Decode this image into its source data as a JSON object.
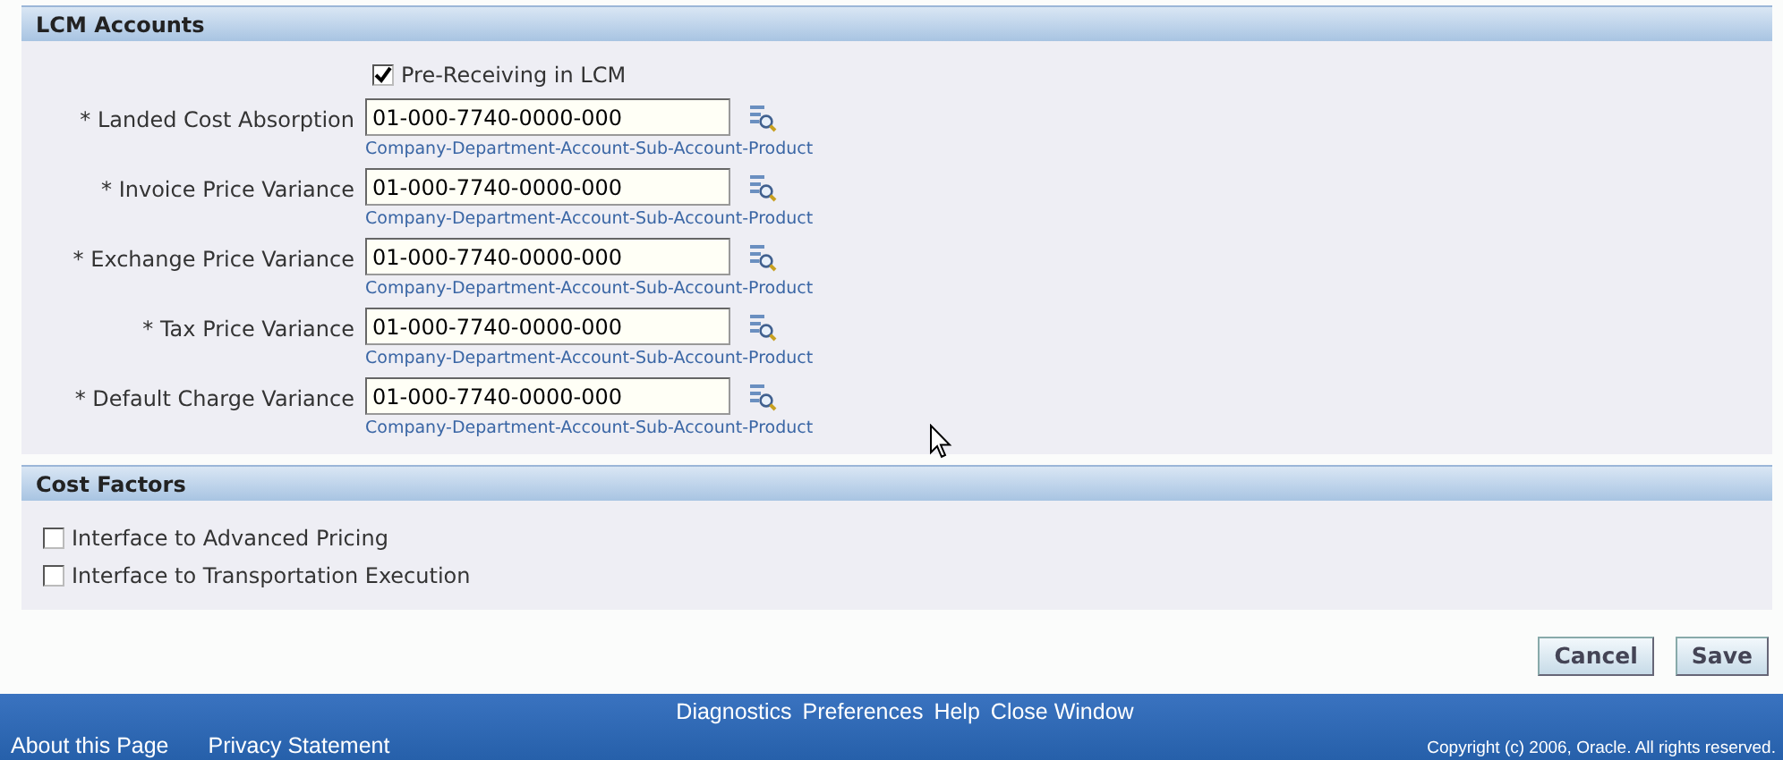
{
  "sections": [
    {
      "title": "LCM Accounts",
      "kind": "accounts",
      "checkbox": {
        "label": "Pre-Receiving in LCM",
        "checked": true
      },
      "fields": [
        {
          "label": "* Landed Cost Absorption",
          "value": "01-000-7740-0000-000",
          "hint": "Company-Department-Account-Sub-Account-Product"
        },
        {
          "label": "* Invoice Price Variance",
          "value": "01-000-7740-0000-000",
          "hint": "Company-Department-Account-Sub-Account-Product"
        },
        {
          "label": "* Exchange Price Variance",
          "value": "01-000-7740-0000-000",
          "hint": "Company-Department-Account-Sub-Account-Product"
        },
        {
          "label": "* Tax Price Variance",
          "value": "01-000-7740-0000-000",
          "hint": "Company-Department-Account-Sub-Account-Product"
        },
        {
          "label": "* Default Charge Variance",
          "value": "01-000-7740-0000-000",
          "hint": "Company-Department-Account-Sub-Account-Product"
        }
      ]
    },
    {
      "title": "Cost Factors",
      "kind": "checkboxes",
      "checkboxes": [
        {
          "label": "Interface to Advanced Pricing",
          "checked": false
        },
        {
          "label": "Interface to Transportation Execution",
          "checked": false
        }
      ]
    }
  ],
  "buttons": [
    "Cancel",
    "Save"
  ],
  "footer": {
    "links": [
      "Diagnostics",
      "Preferences",
      "Help",
      "Close Window"
    ],
    "bottom_links": [
      "About this Page",
      "Privacy Statement"
    ],
    "copyright": "Copyright (c) 2006, Oracle. All rights reserved."
  }
}
